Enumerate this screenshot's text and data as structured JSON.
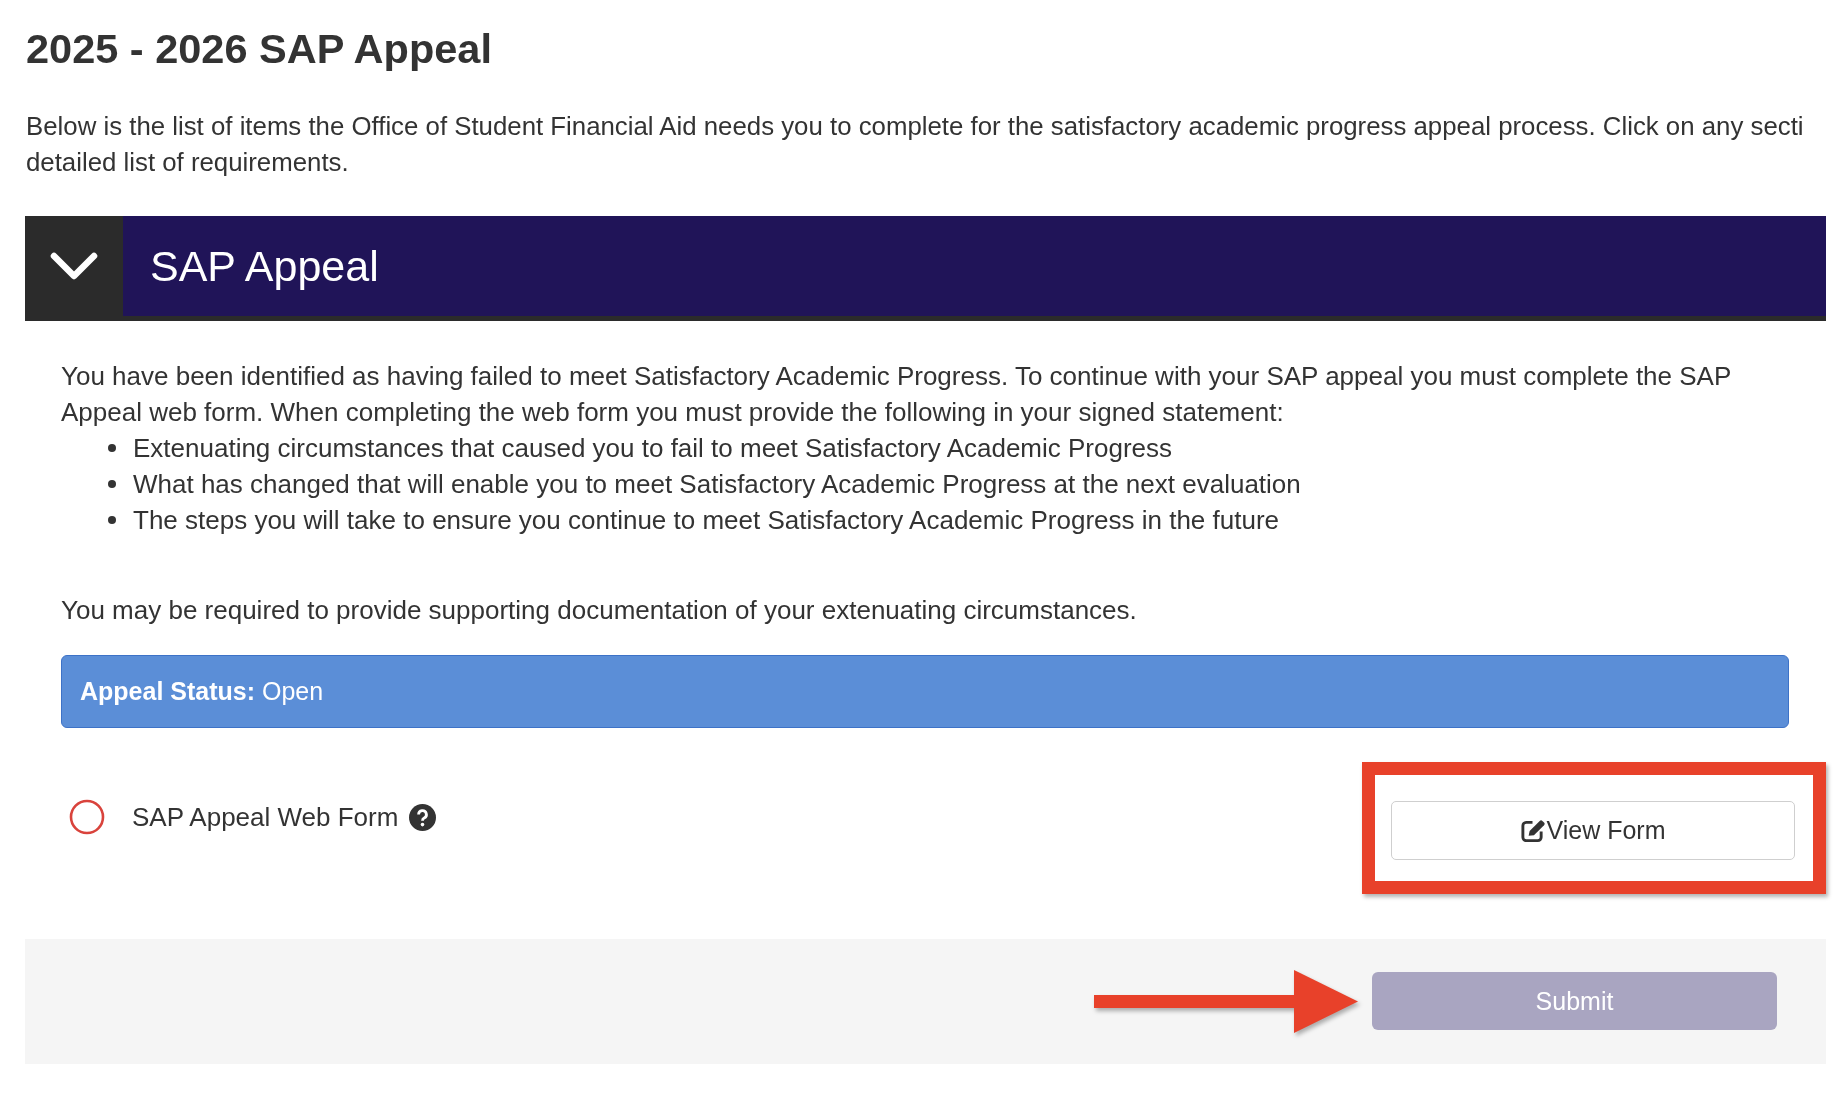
{
  "page": {
    "title": "2025 - 2026 SAP Appeal",
    "intro_lines": [
      "Below is the list of items the Office of Student Financial Aid needs you to complete for the satisfactory academic progress appeal process. Click on any secti",
      "detailed list of requirements."
    ]
  },
  "section": {
    "title": "SAP Appeal",
    "expanded": true,
    "instructions": "You have been identified as having failed to meet Satisfactory Academic Progress. To continue with your SAP appeal you must complete the SAP Appeal web form. When completing the web form you must provide the following in your signed statement:",
    "requirements": [
      "Extenuating circumstances that caused you to fail to meet Satisfactory Academic Progress",
      "What has changed that will enable you to meet Satisfactory Academic Progress at the next evaluation",
      "The steps you will take to ensure you continue to meet Satisfactory Academic Progress in the future"
    ],
    "note": "You may be required to provide supporting documentation of your extenuating circumstances.",
    "status": "**Appeal Status:** Open",
    "items": [
      {
        "label": "SAP Appeal Web Form",
        "complete": false,
        "help": true,
        "button": {
          "label": "View Form",
          "highlight_box": true
        }
      }
    ],
    "submit": {
      "label": "Submit",
      "disabled": true,
      "highlight_arrow": true
    }
  }
}
